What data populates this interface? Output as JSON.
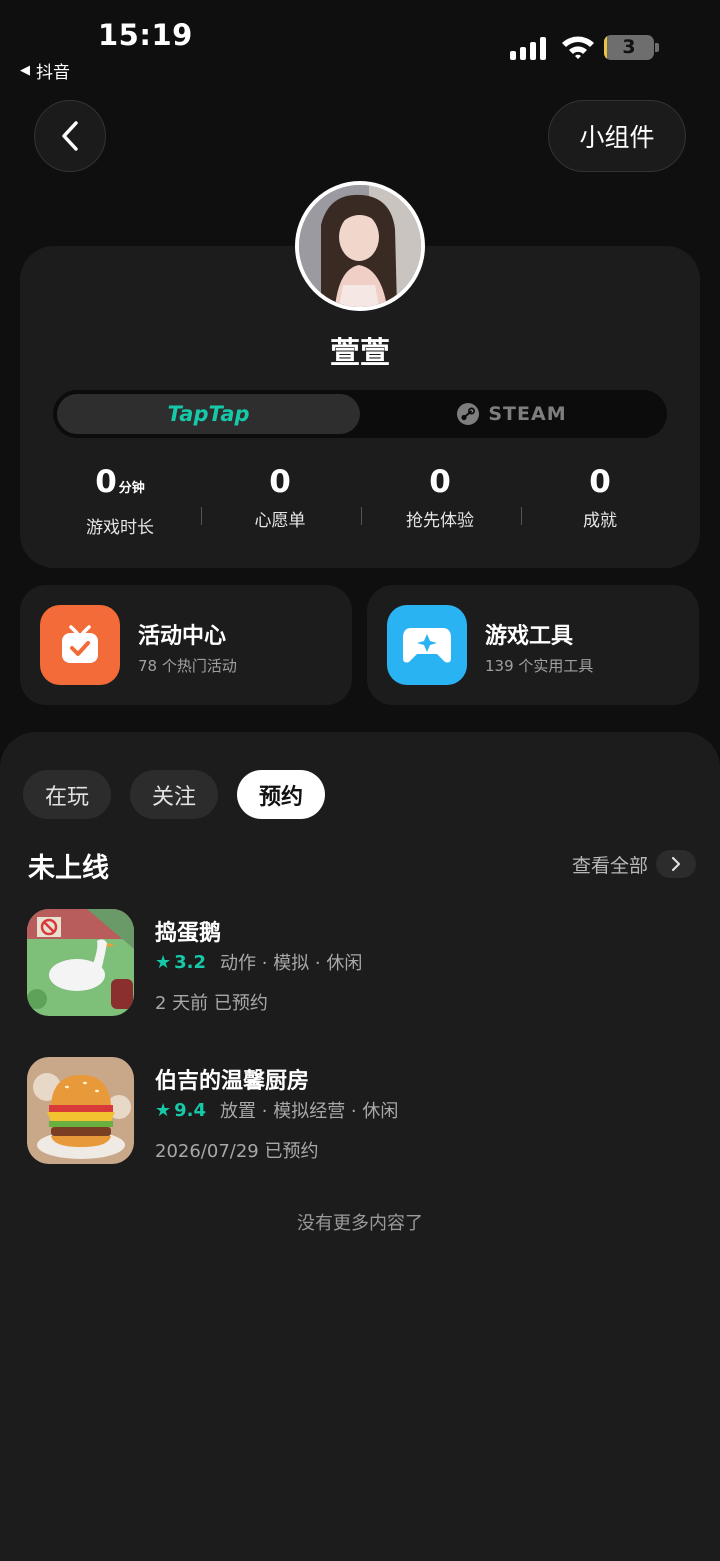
{
  "status_bar": {
    "time": "15:19",
    "back_app": "抖音",
    "battery": "3",
    "battery_level": 0.05
  },
  "top": {
    "widget_label": "小组件"
  },
  "profile": {
    "username": "萱萱",
    "platforms": [
      {
        "label": "TapTap",
        "active": true
      },
      {
        "label": "STEAM",
        "active": false
      }
    ],
    "stats": [
      {
        "value": "0",
        "unit": "分钟",
        "label": "游戏时长"
      },
      {
        "value": "0",
        "unit": "",
        "label": "心愿单"
      },
      {
        "value": "0",
        "unit": "",
        "label": "抢先体验"
      },
      {
        "value": "0",
        "unit": "",
        "label": "成就"
      }
    ]
  },
  "shortcuts": [
    {
      "title": "活动中心",
      "sub": "78 个热门活动",
      "color": "#f46b3a",
      "icon": "tv-check-icon"
    },
    {
      "title": "游戏工具",
      "sub": "139 个实用工具",
      "color": "#2ab3f2",
      "icon": "gamepad-icon"
    }
  ],
  "tabs": [
    {
      "label": "在玩",
      "active": false
    },
    {
      "label": "关注",
      "active": false
    },
    {
      "label": "预约",
      "active": true
    }
  ],
  "section": {
    "title": "未上线",
    "see_all": "查看全部"
  },
  "games": [
    {
      "name": "捣蛋鹅",
      "rating": "3.2",
      "tags": "动作 · 模拟 · 休闲",
      "status": "2 天前 已预约"
    },
    {
      "name": "伯吉的温馨厨房",
      "rating": "9.4",
      "tags": "放置 · 模拟经营 · 休闲",
      "status": "2026/07/29 已预约"
    }
  ],
  "footer": {
    "no_more": "没有更多内容了"
  },
  "colors": {
    "accent": "#16c9a8",
    "background": "#0f0f0f",
    "card": "#1c1c1c"
  }
}
